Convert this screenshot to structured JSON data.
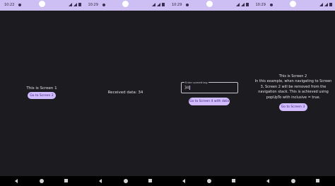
{
  "screens": [
    {
      "time": "10:22",
      "title": "This is Screen 1",
      "button": "Go to Screen 2"
    },
    {
      "time": "10:29",
      "received": "Received data: 34"
    },
    {
      "time": "10:29",
      "field_label": "Enter something",
      "field_value": "34",
      "button": "Go to Screen 4 with data"
    },
    {
      "time": "10:29",
      "title": "This is Screen 2",
      "description": "In this example, when navigating to Screen 3, Screen 2 will be removed from the navigation stack. This is achieved using popUpTo with inclusive = true.",
      "button": "Go to Screen 3"
    }
  ],
  "colors": {
    "status_bar": "#cdbff3",
    "background": "#1c1b1f",
    "button": "#d0bcff",
    "button_text": "#381e72",
    "text": "#e6e1e5"
  }
}
